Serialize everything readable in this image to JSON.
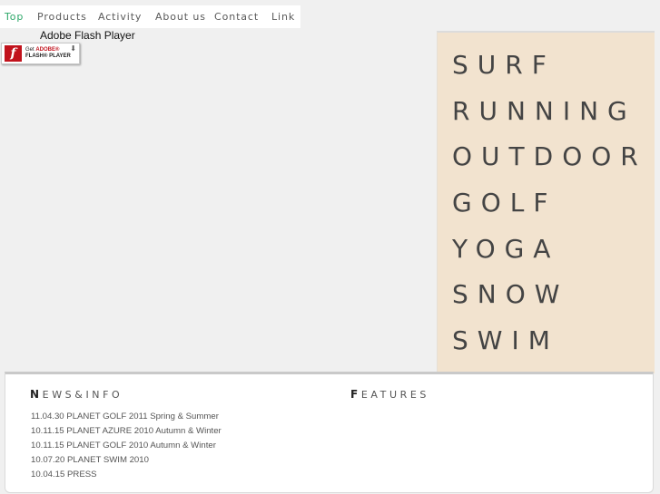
{
  "nav": {
    "items": [
      {
        "label": "Top",
        "active": true
      },
      {
        "label": "Products",
        "active": false
      },
      {
        "label": "Activity",
        "active": false
      },
      {
        "label": "About us",
        "active": false
      },
      {
        "label": "Contact",
        "active": false
      },
      {
        "label": "Link",
        "active": false
      }
    ],
    "active_color": "#2ea86a"
  },
  "flash": {
    "label": "Adobe Flash Player",
    "badge_line1_prefix": "Get",
    "badge_line1_brand": "ADOBE®",
    "badge_line2": "FLASH® PLAYER",
    "logo_icon": "flash-f-icon",
    "download_icon": "download-arrow-icon",
    "brand_color": "#c1121c"
  },
  "categories": {
    "items": [
      "SURF",
      "RUNNING",
      "OUTDOOR",
      "GOLF",
      "YOGA",
      "SNOW",
      "SWIM"
    ],
    "panel_color": "#f2e3cf"
  },
  "news": {
    "title_initial": "N",
    "title_rest": "EWS&INFO",
    "items": [
      "11.04.30 PLANET GOLF 2011 Spring & Summer",
      "10.11.15 PLANET AZURE 2010 Autumn & Winter",
      "10.11.15 PLANET GOLF 2010 Autumn & Winter",
      "10.07.20 PLANET SWIM 2010",
      "10.04.15 PRESS"
    ]
  },
  "features": {
    "title_initial": "F",
    "title_rest": "EATURES"
  }
}
